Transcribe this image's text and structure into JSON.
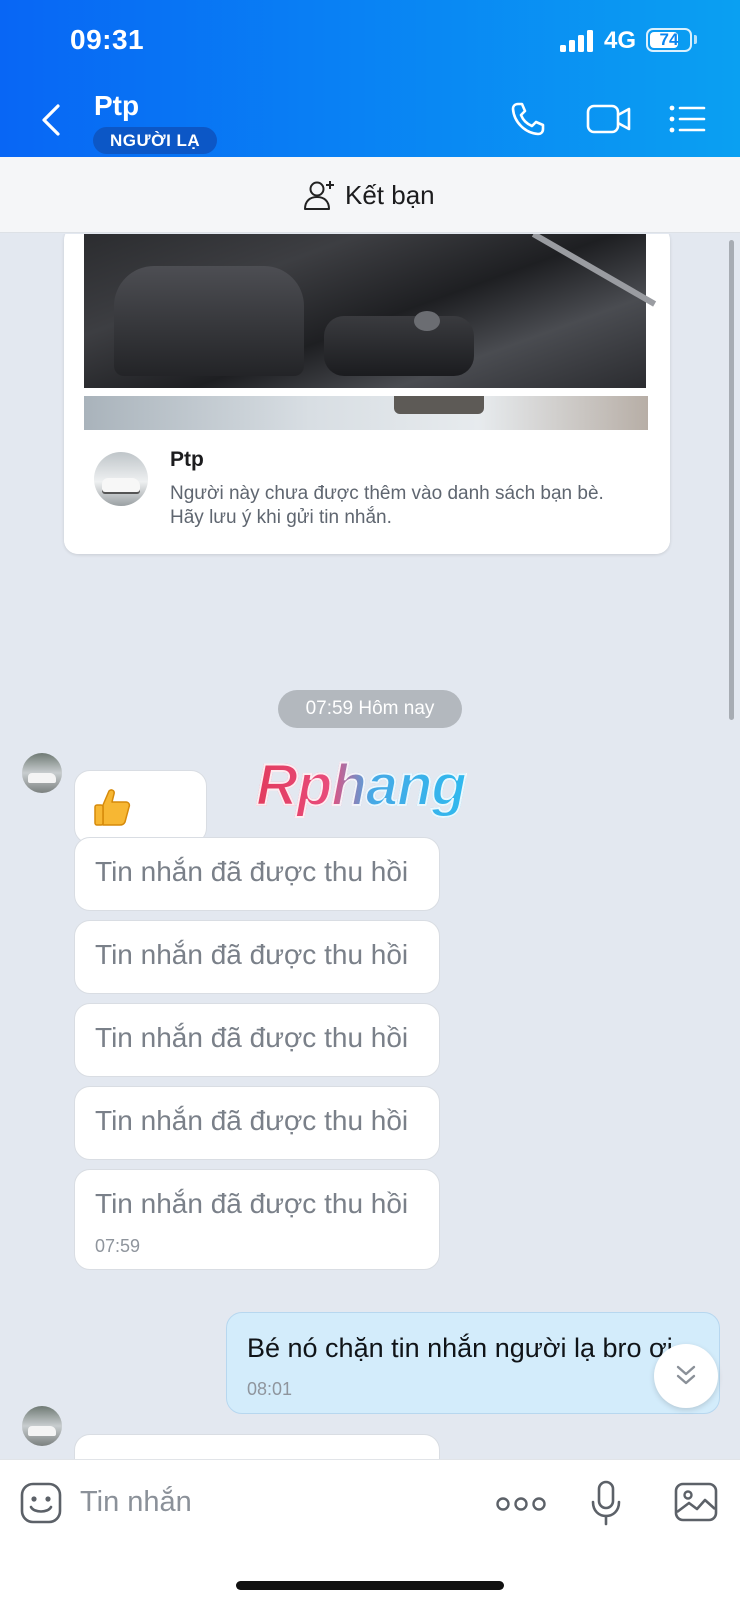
{
  "status_bar": {
    "time": "09:31",
    "network": "4G",
    "battery": "74",
    "battery_level": 0.74
  },
  "header": {
    "contact_name": "Ptp",
    "badge": "NGƯỜI LẠ"
  },
  "add_friend": {
    "label": "Kết bạn"
  },
  "profile_card": {
    "name": "Ptp",
    "note": "Người này chưa được thêm vào danh sách bạn bè. Hãy lưu ý khi gửi tin nhắn."
  },
  "chat": {
    "date_pill": "07:59 Hôm nay",
    "watermark": "Rphang",
    "recalled": [
      {
        "text": "Tin nhắn đã được thu hồi"
      },
      {
        "text": "Tin nhắn đã được thu hồi"
      },
      {
        "text": "Tin nhắn đã được thu hồi"
      },
      {
        "text": "Tin nhắn đã được thu hồi"
      },
      {
        "text": "Tin nhắn đã được thu hồi",
        "time": "07:59"
      }
    ],
    "sent": {
      "text": "Bé nó chặn tin nhắn người lạ bro ơi",
      "time": "08:01"
    }
  },
  "composer": {
    "placeholder": "Tin nhắn"
  },
  "colors": {
    "header_start": "#0866f5",
    "header_end": "#0aa0f2",
    "sent_bubble": "#d3ecfb",
    "chat_bg": "#e3e8f0"
  }
}
